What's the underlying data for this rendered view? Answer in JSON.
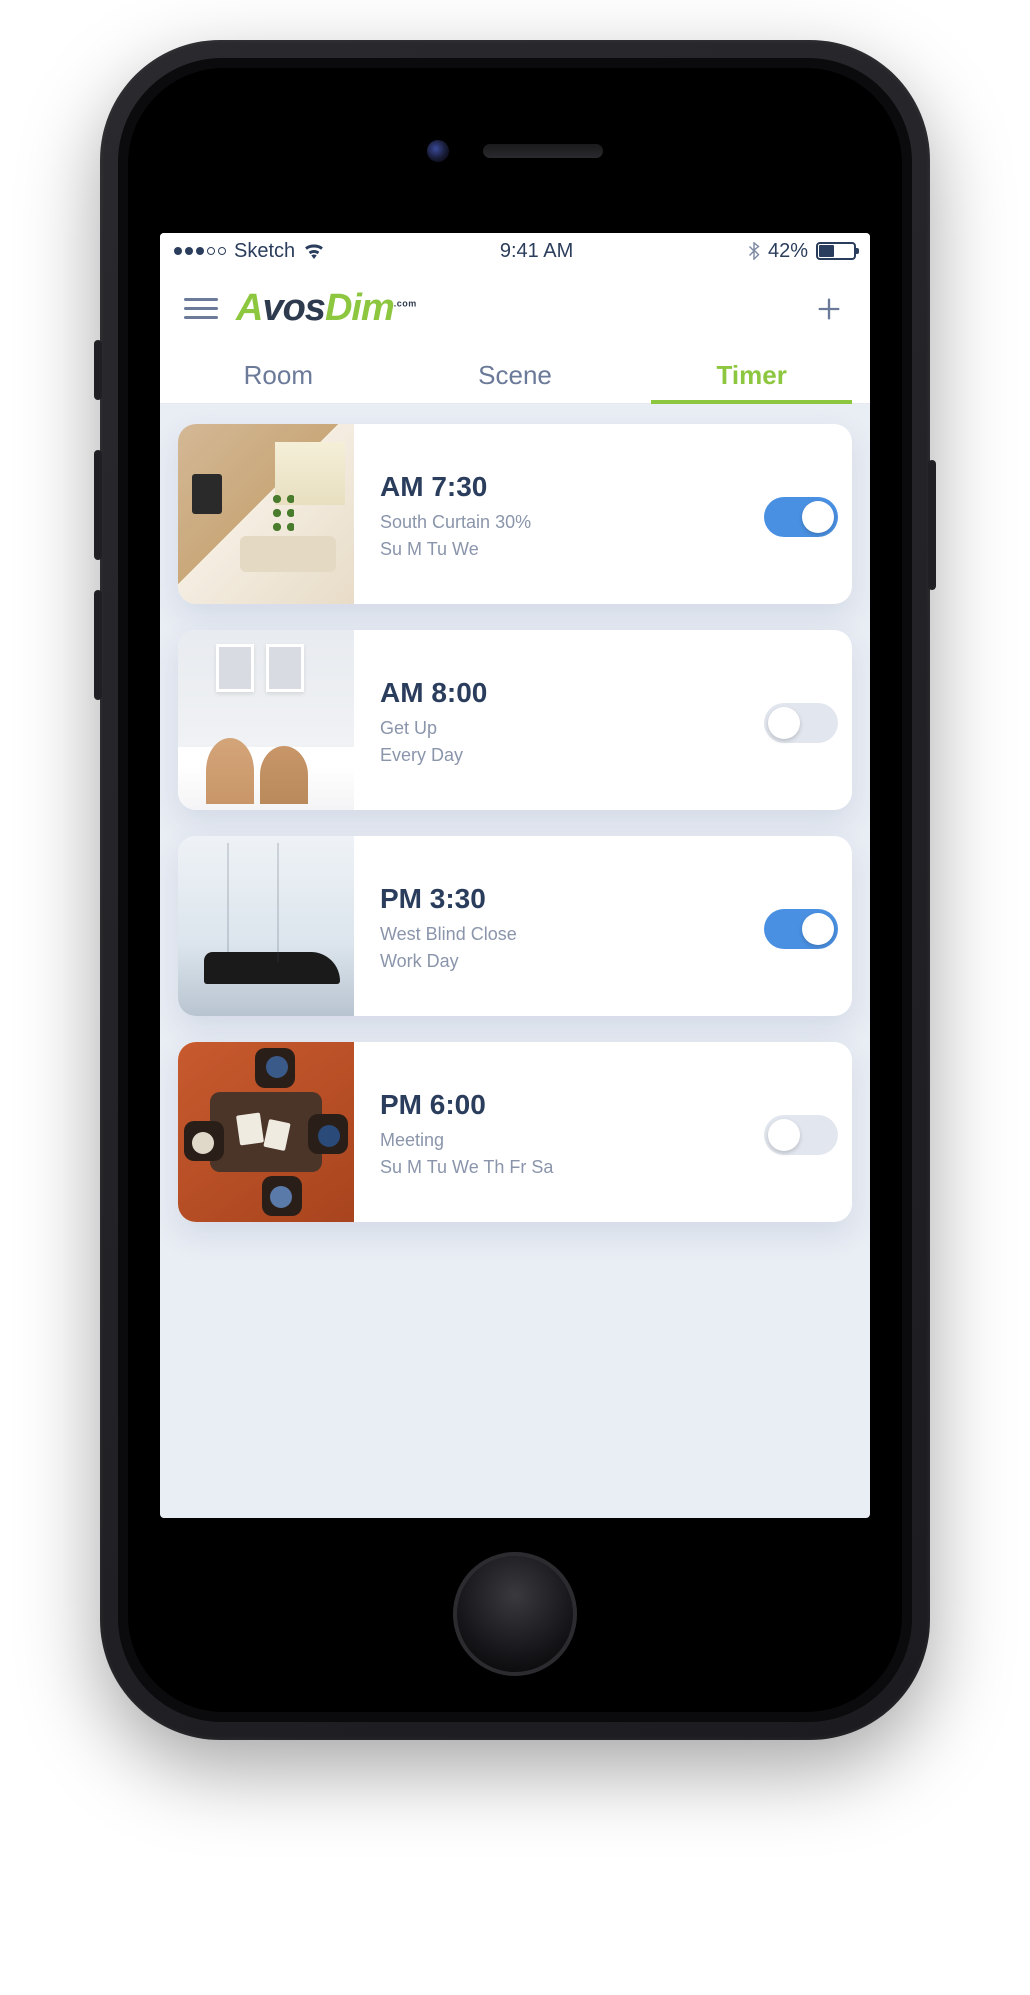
{
  "status": {
    "carrier": "Sketch",
    "time": "9:41 AM",
    "battery_pct": "42%"
  },
  "header": {
    "logo_a": "A",
    "logo_vos": "vos",
    "logo_dim": "Dim",
    "logo_sup": ".com"
  },
  "tabs": {
    "room": "Room",
    "scene": "Scene",
    "timer": "Timer",
    "active": "timer"
  },
  "timers": [
    {
      "time": "AM 7:30",
      "line1": "South Curtain  30%",
      "line2": "Su M Tu We",
      "enabled": true,
      "thumb": "living-room"
    },
    {
      "time": "AM 8:00",
      "line1": "Get Up",
      "line2": "Every Day",
      "enabled": false,
      "thumb": "bedroom"
    },
    {
      "time": "PM 3:30",
      "line1": "West Blind  Close",
      "line2": "Work Day",
      "enabled": true,
      "thumb": "window-lounge"
    },
    {
      "time": "PM 6:00",
      "line1": "Meeting",
      "line2": "Su M Tu We Th Fr Sa",
      "enabled": false,
      "thumb": "meeting"
    }
  ]
}
